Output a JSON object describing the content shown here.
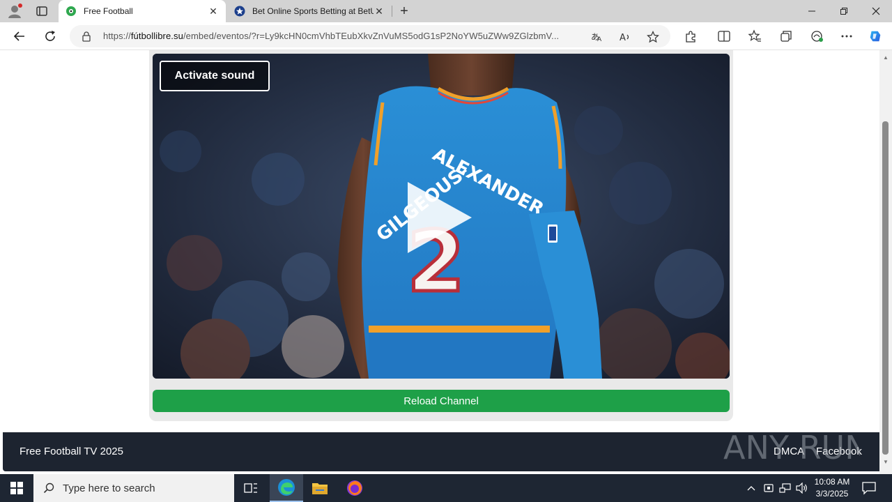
{
  "browser": {
    "tabs": [
      {
        "title": "Free Football",
        "active": true,
        "favicon": "soccer-ball-icon"
      },
      {
        "title": "Bet Online Sports Betting at BetU",
        "active": false,
        "favicon": "star-badge-icon"
      }
    ],
    "address": {
      "scheme": "https://",
      "host": "fútbollibre.su",
      "path": "/embed/eventos/?r=Ly9kcHN0cmVhbTEubXkvZnVuMS5odG1sP2NoYW5uZWw9ZGlzbmV..."
    },
    "window_controls": [
      "minimize",
      "restore",
      "close"
    ]
  },
  "page": {
    "player": {
      "activate_sound_label": "Activate sound",
      "play_icon": "play-icon"
    },
    "reload_label": "Reload Channel",
    "footer": {
      "copyright": "Free Football TV 2025",
      "links": [
        "DMCA",
        "Facebook"
      ]
    },
    "watermark": "ANY RUN"
  },
  "taskbar": {
    "search_placeholder": "Type here to search",
    "clock_time": "10:08 AM",
    "clock_date": "3/3/2025"
  },
  "colors": {
    "reload_green": "#1ea048",
    "footer_bg": "#1d2430",
    "taskbar_bg": "#1e2633",
    "jersey_blue": "#2a8fd6"
  }
}
